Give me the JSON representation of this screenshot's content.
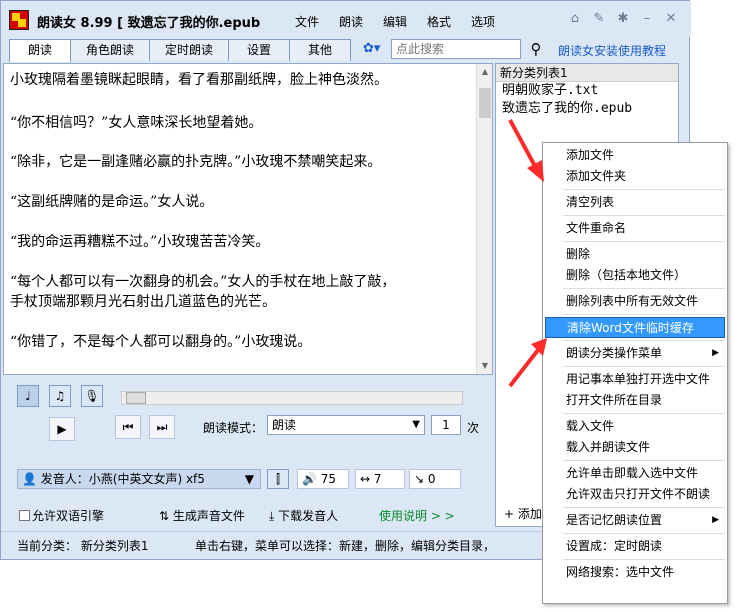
{
  "app": {
    "title": "朗读女 8.99 [ 致遗忘了我的你.epub",
    "menu": [
      "文件",
      "朗读",
      "编辑",
      "格式",
      "选项"
    ],
    "title_icons": [
      "home-icon",
      "pin-icon",
      "settings-icon",
      "minimize-icon",
      "close-icon"
    ]
  },
  "tabs": [
    "朗读",
    "角色朗读",
    "定时朗读",
    "设置",
    "其他"
  ],
  "search": {
    "placeholder": "点此搜索",
    "tutorial_link": "朗读女安装使用教程"
  },
  "text": {
    "paragraphs": [
      "小玫瑰隔着墨镜眯起眼睛，看了看那副纸牌，脸上神色淡然。",
      "“你不相信吗？”女人意味深长地望着她。",
      "“除非，它是一副逢赌必赢的扑克牌。”小玫瑰不禁嘲笑起来。",
      "“这副纸牌赌的是命运。”女人说。",
      "“我的命运再糟糕不过。”小玫瑰苦苦冷笑。",
      "“每个人都可以有一次翻身的机会。”女人的手杖在地上敲了敲，",
      "手杖顶端那颗月光石射出几道蓝色的光芒。",
      "“你错了，不是每个人都可以翻身的。”小玫瑰说。"
    ]
  },
  "controls": {
    "mode_label": "朗读模式：",
    "mode_value": "朗读",
    "count_value": "1",
    "count_suffix": "次",
    "voice": "发音人：小燕(中英文女声) xf5",
    "volume": "75",
    "speed": "7",
    "pitch": "0",
    "bilingual": "允许双语引擎",
    "generate_audio": "生成声音文件",
    "download_voice": "下载发音人",
    "help_link": "使用说明 > >"
  },
  "list": {
    "header": "新分类列表1",
    "items": [
      "明朝败家子.txt",
      "致遗忘了我的你.epub"
    ],
    "add_label": "+ 添加"
  },
  "status": {
    "category": "当前分类：  新分类列表1",
    "hint": "单击右键，菜单可以选择：新建，删除，编辑分类目录，"
  },
  "context_menu": {
    "groups": [
      [
        "添加文件",
        "添加文件夹"
      ],
      [
        "清空列表"
      ],
      [
        "文件重命名"
      ],
      [
        "删除",
        "删除（包括本地文件）"
      ],
      [
        "删除列表中所有无效文件"
      ],
      [
        "清除Word文件临时缓存"
      ],
      [
        "朗读分类操作菜单"
      ],
      [
        "用记事本单独打开选中文件",
        "打开文件所在目录"
      ],
      [
        "载入文件",
        "载入并朗读文件"
      ],
      [
        "允许单击即载入选中文件",
        "允许双击只打开文件不朗读"
      ],
      [
        "是否记忆朗读位置"
      ],
      [
        "设置成：定时朗读"
      ],
      [
        "网络搜索：选中文件"
      ]
    ],
    "highlighted": "清除Word文件临时缓存",
    "submenu_items": [
      "朗读分类操作菜单",
      "是否记忆朗读位置"
    ]
  },
  "colors": {
    "window_bg": "#dce7f5",
    "highlight": "#3399ff",
    "arrow": "#ff2a2a",
    "link": "#1a5cc8",
    "green_link": "#0a8a2a"
  }
}
